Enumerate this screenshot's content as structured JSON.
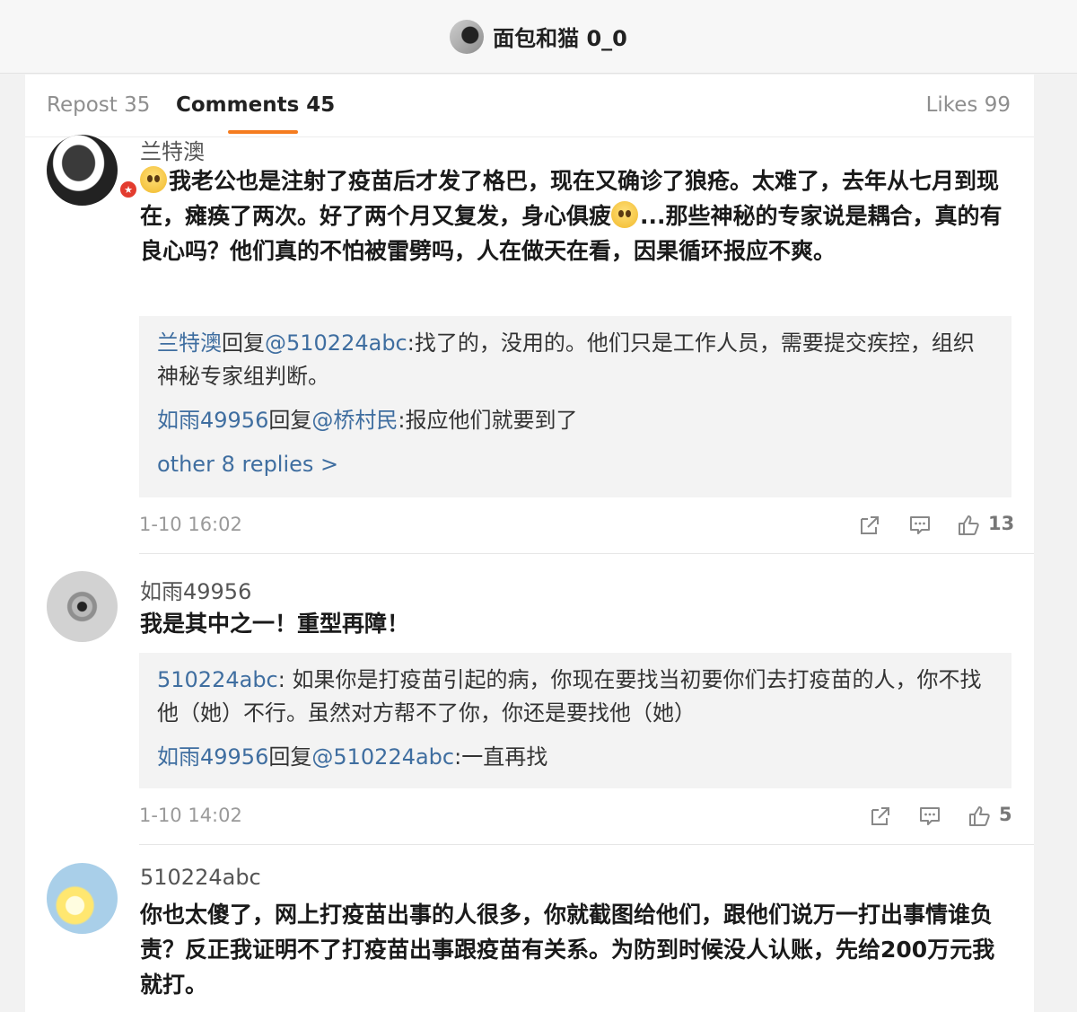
{
  "header": {
    "title": "面包和猫 0_0"
  },
  "tabs": {
    "repost": "Repost 35",
    "comments": "Comments 45",
    "likes": "Likes 99"
  },
  "comments": [
    {
      "name": "兰特澳",
      "text": "我老公也是注射了疫苗后才发了格巴，现在又确诊了狼疮。太难了，去年从七月到现在，瘫痪了两次。好了两个月又复发，身心俱疲",
      "text2": "...那些神秘的专家说是耦合，真的有良心吗？他们真的不怕被雷劈吗，人在做天在看，因果循环报应不爽。",
      "replies": [
        {
          "author": "兰特澳",
          "verb": "回复",
          "target": "@510224abc",
          "text": ":找了的，没用的。他们只是工作人员，需要提交疾控，组织神秘专家组判断。"
        },
        {
          "author": "如雨49956",
          "verb": "回复",
          "target": "@桥村民",
          "text": ":报应他们就要到了"
        }
      ],
      "more": "other 8 replies >",
      "time": "1-10 16:02",
      "likes": "13"
    },
    {
      "name": "如雨49956",
      "text": "我是其中之一！重型再障！",
      "replies": [
        {
          "author": "510224abc",
          "text": ": 如果你是打疫苗引起的病，你现在要找当初要你们去打疫苗的人，你不找他（她）不行。虽然对方帮不了你，你还是要找他（她）"
        },
        {
          "author": "如雨49956",
          "verb": "回复",
          "target": "@510224abc",
          "text": ":一直再找"
        }
      ],
      "time": "1-10 14:02",
      "likes": "5"
    },
    {
      "name": "510224abc",
      "text": "你也太傻了，网上打疫苗出事的人很多，你就截图给他们，跟他们说万一打出事情谁负责？反正我证明不了打疫苗出事跟疫苗有关系。为防到时候没人认账，先给200万元我就打。"
    }
  ],
  "icons": {
    "repost": "share-icon",
    "comment": "comment-icon",
    "like": "thumbs-up-icon",
    "verified": "verified-badge-icon"
  },
  "colors": {
    "accent": "#f57c1f",
    "link": "#3f6ea0",
    "badge": "#e33c2f"
  }
}
